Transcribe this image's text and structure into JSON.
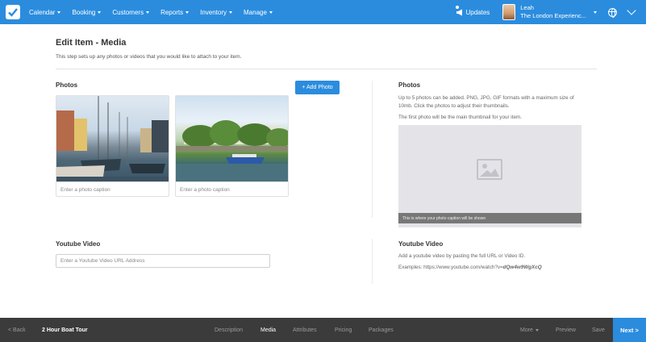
{
  "topnav": {
    "items": [
      {
        "label": "Calendar"
      },
      {
        "label": "Booking"
      },
      {
        "label": "Customers"
      },
      {
        "label": "Reports"
      },
      {
        "label": "Inventory"
      },
      {
        "label": "Manage"
      }
    ],
    "updates_label": "Updates",
    "user_name": "Leah",
    "user_company": "The London Experienc..."
  },
  "page": {
    "title": "Edit Item - Media",
    "description": "This step sets up any photos or videos that you would like to attach to your item."
  },
  "photos": {
    "heading": "Photos",
    "add_button": "+ Add Photo",
    "items": [
      {
        "caption_placeholder": "Enter a photo caption"
      },
      {
        "caption_placeholder": "Enter a photo caption"
      }
    ]
  },
  "photos_help": {
    "heading": "Photos",
    "text1": "Up to 5 photos can be added. PNG, JPG, GIF formats with a maximum size of 10mb. Click the photos to adjust their thumbnails.",
    "text2": "The first photo will be the main thumbnail for your item.",
    "preview_caption": "This is where your photo caption will be shown"
  },
  "youtube": {
    "heading": "Youtube Video",
    "placeholder": "Enter a Youtube Video URL Address"
  },
  "youtube_help": {
    "heading": "Youtube Video",
    "text": "Add a youtube video by pasting the full URL or Video ID.",
    "examples_label": "Examples: https://www.youtube.com/watch?v=",
    "examples_id": "dQw4w9WgXcQ"
  },
  "bottombar": {
    "back": "< Back",
    "item_name": "2 Hour Boat Tour",
    "steps": [
      "Description",
      "Media",
      "Attributes",
      "Pricing",
      "Packages"
    ],
    "active_step": "Media",
    "more": "More",
    "preview": "Preview",
    "save": "Save",
    "next": "Next >"
  },
  "colors": {
    "brand": "#2b8cde",
    "bottombar": "#3b3b3b"
  }
}
